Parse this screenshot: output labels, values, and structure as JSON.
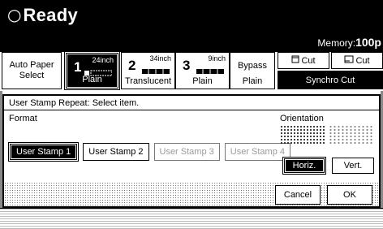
{
  "status": {
    "icon": "power-cycle-icon",
    "text": "Ready"
  },
  "memory": {
    "label": "Memory:",
    "value": "100p"
  },
  "paper": {
    "auto": {
      "line1": "Auto Paper",
      "line2": "Select"
    },
    "trays": [
      {
        "num": "1",
        "size": "24inch",
        "type": "Plain",
        "selected": true
      },
      {
        "num": "2",
        "size": "34inch",
        "type": "Translucent",
        "selected": false
      },
      {
        "num": "3",
        "size": "9inch",
        "type": "Plain",
        "selected": false
      }
    ],
    "bypass": {
      "line1": "Bypass",
      "line2": "Plain"
    }
  },
  "cut": {
    "first": {
      "icon": "preset-cut-icon",
      "label": "Cut"
    },
    "second": {
      "icon": "custom-cut-icon",
      "label": "Cut"
    },
    "synchro": "Synchro Cut"
  },
  "dialog": {
    "prompt": "User Stamp Repeat: Select item.",
    "format_label": "Format",
    "stamps": [
      {
        "label": "User Stamp 1",
        "state": "selected"
      },
      {
        "label": "User Stamp 2",
        "state": "enabled"
      },
      {
        "label": "User Stamp 3",
        "state": "disabled"
      },
      {
        "label": "User Stamp 4",
        "state": "disabled"
      }
    ],
    "orientation_label": "Orientation",
    "horiz": "Horiz.",
    "vert": "Vert.",
    "cancel": "Cancel",
    "ok": "OK"
  }
}
